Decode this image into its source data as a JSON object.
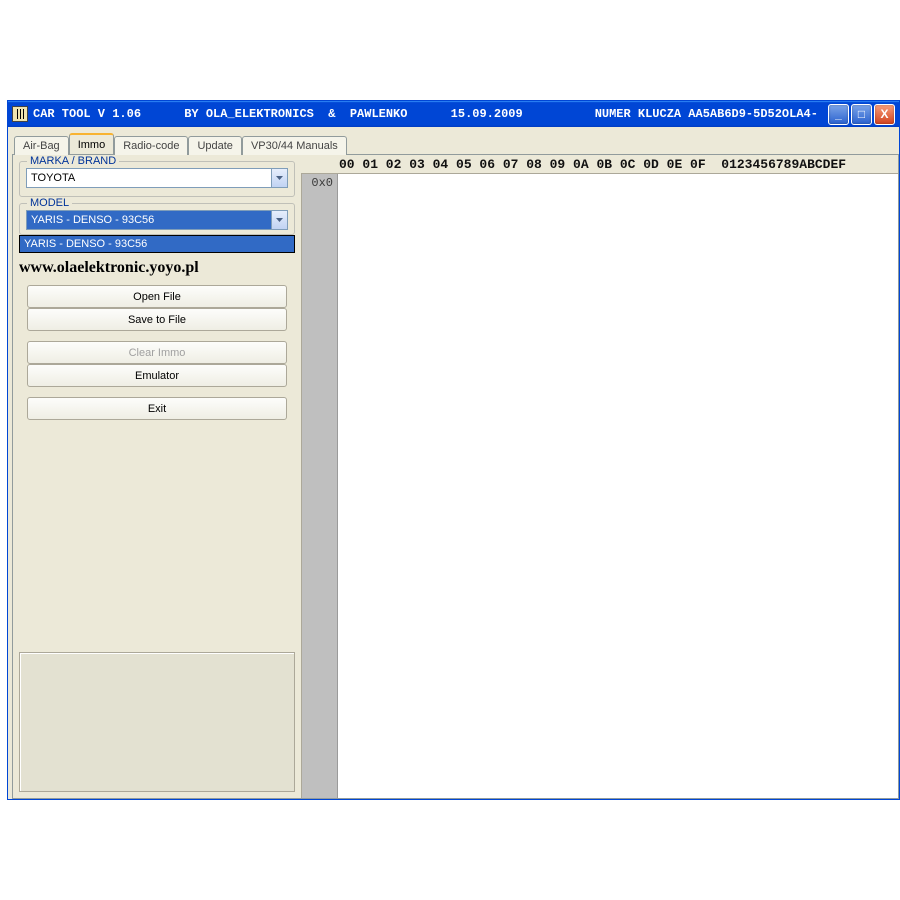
{
  "titlebar": {
    "text": "CAR TOOL V 1.06      BY OLA_ELEKTRONICS  &  PAWLENKO      15.09.2009          NUMER KLUCZA AA5AB6D9-5D52OLA4-"
  },
  "win_controls": {
    "min_glyph": "_",
    "max_glyph": "□",
    "close_glyph": "X"
  },
  "tabs": [
    {
      "id": "airbag",
      "label": "Air-Bag",
      "active": false
    },
    {
      "id": "immo",
      "label": "Immo",
      "active": true
    },
    {
      "id": "radiocode",
      "label": "Radio-code",
      "active": false
    },
    {
      "id": "update",
      "label": "Update",
      "active": false
    },
    {
      "id": "manuals",
      "label": "VP30/44 Manuals",
      "active": false
    }
  ],
  "left": {
    "brand_legend": "MARKA / BRAND",
    "brand_value": "TOYOTA",
    "model_legend": "MODEL",
    "model_value": "YARIS - DENSO - 93C56",
    "model_dropdown_item": "YARIS - DENSO - 93C56",
    "site_link": "www.olaelektronic.yoyo.pl",
    "buttons": {
      "open_file": "Open File",
      "save_file": "Save to File",
      "clear_immo": "Clear Immo",
      "emulator": "Emulator",
      "exit": "Exit"
    }
  },
  "hex": {
    "header_cols": "00 01 02 03 04 05 06 07 08 09 0A 0B 0C 0D 0E 0F  0123456789ABCDEF",
    "offset0": "0x0"
  }
}
